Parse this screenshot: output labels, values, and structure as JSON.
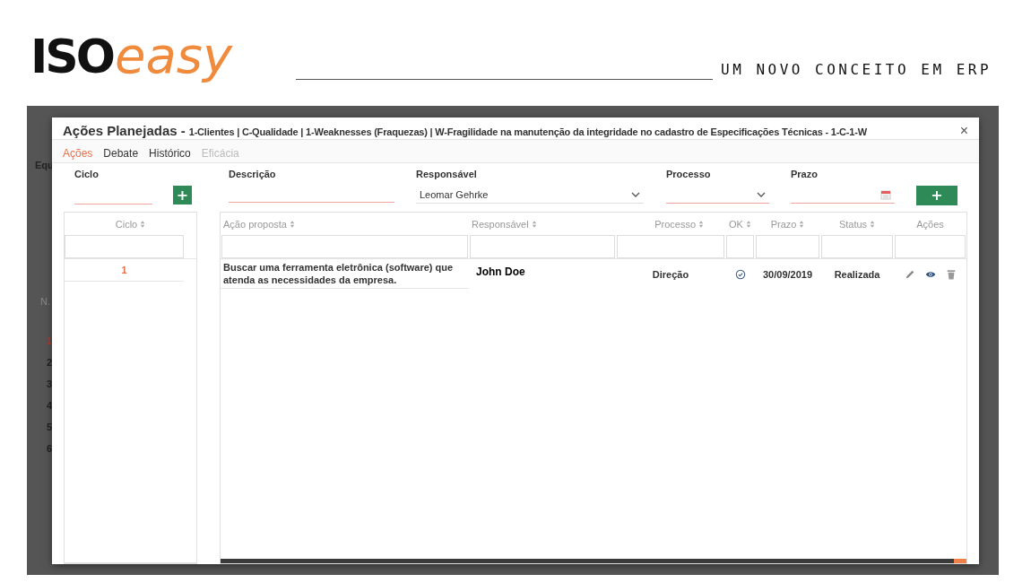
{
  "brand": {
    "logo_bold": "ISO",
    "logo_light": "easy",
    "tagline": "UM NOVO CONCEITO EM ERP"
  },
  "background_app": {
    "labels": [
      "Equ",
      "N."
    ],
    "row_numbers": [
      {
        "text": "1",
        "selected": true
      },
      {
        "text": "2",
        "selected": false
      },
      {
        "text": "3",
        "selected": false
      },
      {
        "text": "4",
        "selected": false
      },
      {
        "text": "5",
        "selected": false
      },
      {
        "text": "6",
        "selected": false
      }
    ]
  },
  "modal": {
    "title": "Ações Planejadas -",
    "subtitle": "1-Clientes | C-Qualidade | 1-Weaknesses (Fraquezas) | W-Fragilidade na manutenção da integridade no cadastro de Especificações Técnicas - 1-C-1-W",
    "close": "×",
    "tabs": [
      {
        "label": "Ações",
        "selected": true,
        "disabled": false
      },
      {
        "label": "Debate",
        "selected": false,
        "disabled": false
      },
      {
        "label": "Histórico",
        "selected": false,
        "disabled": false
      },
      {
        "label": "Eficácia",
        "selected": false,
        "disabled": true
      }
    ],
    "form": {
      "ciclo_label": "Ciclo",
      "add_symbol": "+",
      "descricao_label": "Descrição",
      "responsavel_label": "Responsável",
      "responsavel_value": "Leomar Gehrke",
      "processo_label": "Processo",
      "prazo_label": "Prazo"
    },
    "ciclo_table": {
      "column": "Ciclo",
      "rows": [
        {
          "value": "1",
          "selected": true
        }
      ]
    },
    "actions_table": {
      "columns": [
        {
          "label": "Ação proposta",
          "sortable": true
        },
        {
          "label": "Responsável",
          "sortable": true
        },
        {
          "label": "Processo",
          "sortable": true
        },
        {
          "label": "OK",
          "sortable": true
        },
        {
          "label": "Prazo",
          "sortable": true
        },
        {
          "label": "Status",
          "sortable": true
        },
        {
          "label": "Ações",
          "sortable": false
        }
      ],
      "rows": [
        {
          "acao": "Buscar uma ferramenta eletrônica (software) que atenda as necessidades da empresa.",
          "responsavel": "John Doe",
          "processo": "Direção",
          "ok": true,
          "prazo": "30/09/2019",
          "status": "Realizada"
        }
      ]
    }
  }
}
